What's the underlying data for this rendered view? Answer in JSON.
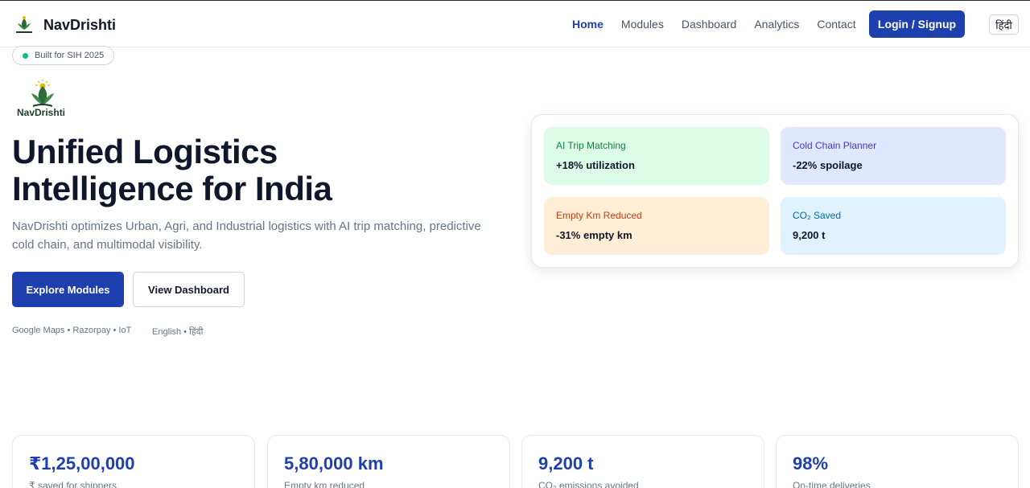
{
  "brand": {
    "name": "NavDrishti",
    "logo_caption": "NavDrishti"
  },
  "nav": {
    "links": [
      "Home",
      "Modules",
      "Dashboard",
      "Analytics",
      "Contact"
    ],
    "active": "Home",
    "login_label": "Login / Signup",
    "language_label": "हिंदी"
  },
  "hero": {
    "badge": "Built for SIH 2025",
    "title_line1": "Unified Logistics",
    "title_line2": "Intelligence for India",
    "subtitle": "NavDrishti optimizes Urban, Agri, and Industrial logistics with AI trip matching, predictive cold chain, and multimodal visibility.",
    "primary_button": "Explore Modules",
    "secondary_button": "View Dashboard",
    "integrations": "Google Maps • Razorpay • IoT",
    "languages": "English • हिंदी"
  },
  "features": [
    {
      "label": "AI Trip Matching",
      "value": "+18% utilization"
    },
    {
      "label": "Cold Chain Planner",
      "value": "-22% spoilage"
    },
    {
      "label": "Empty Km Reduced",
      "value": "-31% empty km"
    },
    {
      "label": "CO₂ Saved",
      "value": "9,200 t"
    }
  ],
  "stats": [
    {
      "value": "₹1,25,00,000",
      "label": "₹ saved for shippers"
    },
    {
      "value": "5,80,000 km",
      "label": "Empty km reduced"
    },
    {
      "value": "9,200 t",
      "label": "CO₂ emissions avoided"
    },
    {
      "value": "98%",
      "label": "On-time deliveries"
    }
  ],
  "colors": {
    "primary": "#1e40af",
    "badge_dot": "#10b981",
    "logo_green": "#2f6b3a",
    "logo_sun": "#f5b301"
  }
}
